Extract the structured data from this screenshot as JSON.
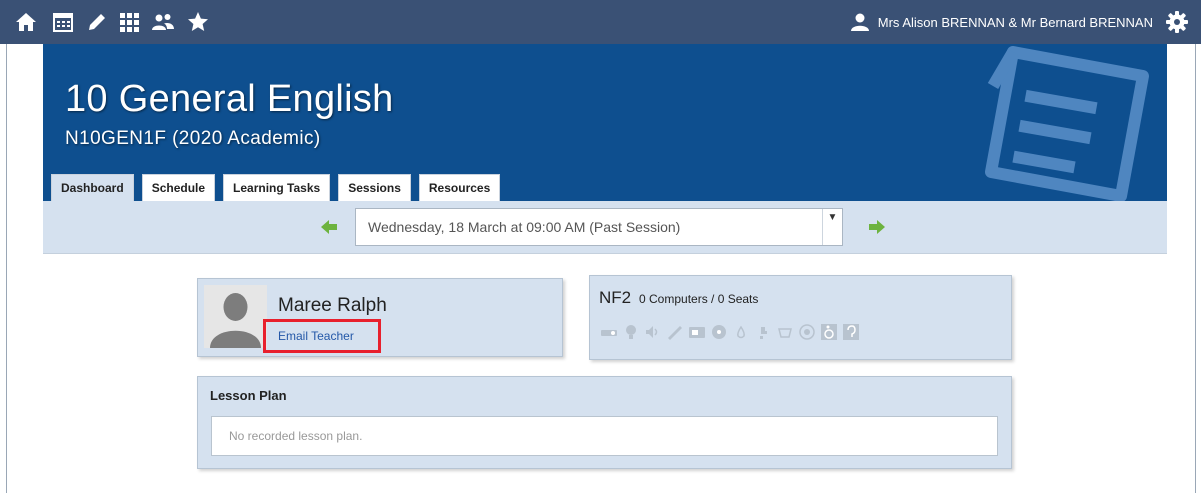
{
  "topnav": {
    "icons": [
      "home-icon",
      "calendar-icon",
      "pencil-icon",
      "grid-icon",
      "people-icon",
      "star-icon"
    ],
    "user_name": "Mrs Alison BRENNAN & Mr Bernard BRENNAN",
    "settings_icon": "gear-icon"
  },
  "banner": {
    "title": "10 General English",
    "subtitle": "N10GEN1F (2020 Academic)",
    "tabs": [
      {
        "label": "Dashboard",
        "active": true
      },
      {
        "label": "Schedule",
        "active": false
      },
      {
        "label": "Learning Tasks",
        "active": false
      },
      {
        "label": "Sessions",
        "active": false
      },
      {
        "label": "Resources",
        "active": false
      }
    ]
  },
  "session": {
    "selected": "Wednesday, 18 March at 09:00 AM (Past Session)"
  },
  "teacher": {
    "name": "Maree Ralph",
    "email_label": "Email Teacher"
  },
  "room": {
    "name": "NF2",
    "meta": "0 Computers / 0 Seats",
    "facility_icons": [
      "projector-icon",
      "lightbulb-icon",
      "speaker-icon",
      "whiteboard-icon",
      "tv-icon",
      "disc-icon",
      "water-icon",
      "tap-icon",
      "sink-icon",
      "target-icon",
      "wheelchair-icon",
      "hearing-icon"
    ]
  },
  "lesson_plan": {
    "title": "Lesson Plan",
    "placeholder": "No recorded lesson plan."
  },
  "colors": {
    "nav_bg": "#3a5175",
    "banner_bg": "#0e4f8f",
    "panel_bg": "#d5e1ef",
    "arrow_green": "#6db33f",
    "highlight_red": "#e8202d",
    "link_blue": "#2458a8"
  }
}
